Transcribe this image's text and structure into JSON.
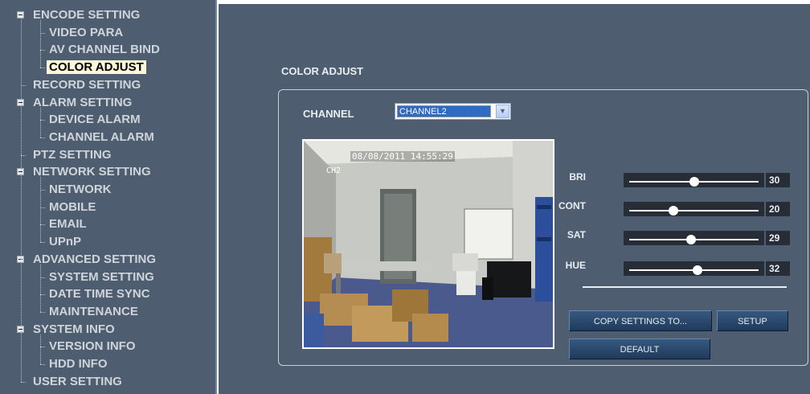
{
  "tree": [
    {
      "label": "ENCODE SETTING",
      "level": 0,
      "expandable": true
    },
    {
      "label": "VIDEO PARA",
      "level": 1
    },
    {
      "label": "AV CHANNEL BIND",
      "level": 1
    },
    {
      "label": "COLOR ADJUST",
      "level": 1,
      "selected": true
    },
    {
      "label": "RECORD SETTING",
      "level": 0
    },
    {
      "label": "ALARM SETTING",
      "level": 0,
      "expandable": true
    },
    {
      "label": "DEVICE ALARM",
      "level": 1
    },
    {
      "label": "CHANNEL ALARM",
      "level": 1
    },
    {
      "label": "PTZ SETTING",
      "level": 0
    },
    {
      "label": "NETWORK SETTING",
      "level": 0,
      "expandable": true
    },
    {
      "label": "NETWORK",
      "level": 1
    },
    {
      "label": "MOBILE",
      "level": 1
    },
    {
      "label": "EMAIL",
      "level": 1
    },
    {
      "label": "UPnP",
      "level": 1
    },
    {
      "label": "ADVANCED SETTING",
      "level": 0,
      "expandable": true
    },
    {
      "label": "SYSTEM SETTING",
      "level": 1
    },
    {
      "label": "DATE TIME SYNC",
      "level": 1
    },
    {
      "label": "MAINTENANCE",
      "level": 1
    },
    {
      "label": "SYSTEM INFO",
      "level": 0,
      "expandable": true
    },
    {
      "label": "VERSION INFO",
      "level": 1
    },
    {
      "label": "HDD INFO",
      "level": 1
    },
    {
      "label": "USER SETTING",
      "level": 0
    }
  ],
  "main": {
    "title": "COLOR ADJUST",
    "channel_label": "CHANNEL",
    "channel_value": "CHANNEL2",
    "preview": {
      "osd_datetime": "08/08/2011 14:55:29",
      "osd_channel": "CH2"
    },
    "sliders": [
      {
        "key": "bri",
        "label": "BRI",
        "value": "30",
        "fraction": 0.5
      },
      {
        "key": "cont",
        "label": "CONT",
        "value": "20",
        "fraction": 0.34
      },
      {
        "key": "sat",
        "label": "SAT",
        "value": "29",
        "fraction": 0.48
      },
      {
        "key": "hue",
        "label": "HUE",
        "value": "32",
        "fraction": 0.53
      }
    ],
    "buttons": {
      "copy": "COPY SETTINGS TO...",
      "setup": "SETUP",
      "default": "DEFAULT"
    }
  },
  "colors": {
    "panel_bg": "#4e5e70",
    "selected_bg": "#fbf7d8",
    "button_bg": "#2b4a6e",
    "dropdown_selection": "#316ac5"
  }
}
